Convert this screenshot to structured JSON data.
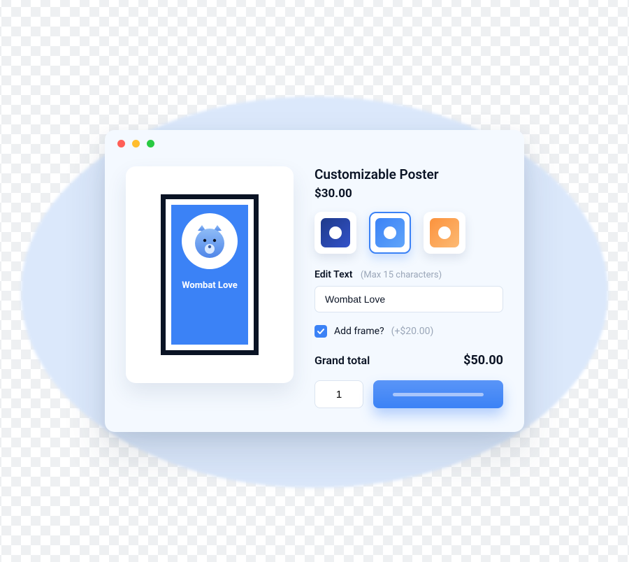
{
  "product": {
    "title": "Customizable Poster",
    "price": "$30.00",
    "preview_caption": "Wombat Love"
  },
  "swatches": {
    "selected_index": 1,
    "options": [
      {
        "bg_css": "linear-gradient(135deg,#1e3a8a,#3352c9)"
      },
      {
        "bg_css": "linear-gradient(135deg,#3b82f6,#60a5fa)"
      },
      {
        "bg_css": "linear-gradient(135deg,#fb923c,#fdba74)"
      }
    ]
  },
  "edit_text": {
    "label": "Edit Text",
    "hint": "(Max 15 characters)",
    "value": "Wombat Love",
    "maxlength": "15"
  },
  "addon": {
    "checked": true,
    "label": "Add frame?",
    "price_text": "(+$20.00)"
  },
  "total": {
    "label": "Grand total",
    "amount": "$50.00"
  },
  "quantity": {
    "value": "1"
  }
}
